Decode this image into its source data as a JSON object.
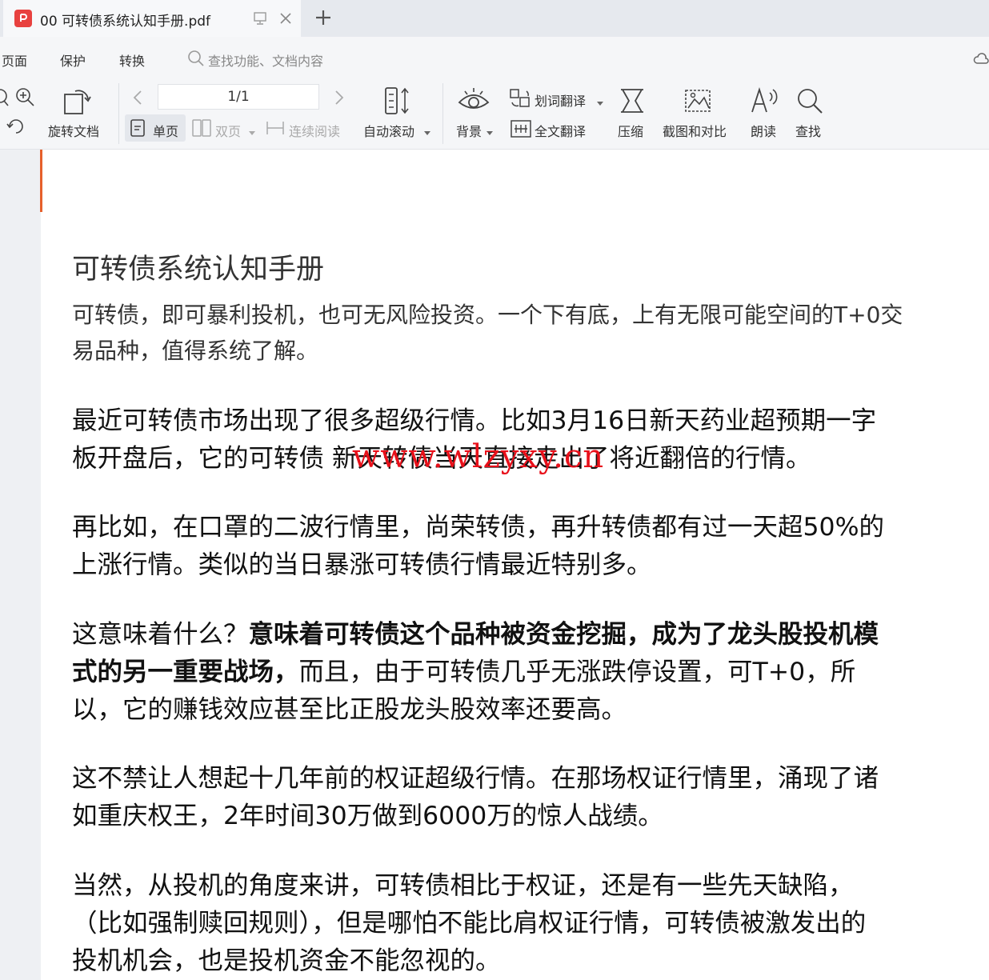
{
  "tab": {
    "title": "00 可转债系统认知手册.pdf"
  },
  "menu": {
    "items": [
      "页面",
      "保护",
      "转换"
    ]
  },
  "search": {
    "placeholder": "查找功能、文档内容"
  },
  "toolbar": {
    "rotate_doc": "旋转文档",
    "page_indicator": "1/1",
    "single_page": "单页",
    "double_page": "双页",
    "continuous_read": "连续阅读",
    "auto_scroll": "自动滚动",
    "background": "背景",
    "word_translate": "划词翻译",
    "full_translate": "全文翻译",
    "compress": "压缩",
    "screenshot_compare": "截图和对比",
    "read_aloud": "朗读",
    "find": "查找"
  },
  "document": {
    "title": "可转债系统认知手册",
    "intro": [
      "可转债，即可暴利投机，也可无风险投资。一个下有底，上有无限可能空间的T+0交",
      "易品种，值得系统了解。"
    ],
    "para1": [
      "最近可转债市场出现了很多超级行情。比如3月16日新天药业超预期一字",
      "板开盘后，它的可转债 新天转债当天直接走出了将近翻倍的行情。"
    ],
    "para2": [
      "再比如，在口罩的二波行情里，尚荣转债，再升转债都有过一天超50%的",
      "上涨行情。类似的当日暴涨可转债行情最近特别多。"
    ],
    "para3": {
      "line1_normal": "这意味着什么？",
      "line1_bold": "意味着可转债这个品种被资金挖掘，成为了龙头股投机模",
      "line2_bold": "式的另一重要战场，",
      "line2_normal": "而且，由于可转债几乎无涨跌停设置，可T+0，所",
      "line3": "以，它的赚钱效应甚至比正股龙头股效率还要高。"
    },
    "para4": [
      "这不禁让人想起十几年前的权证超级行情。在那场权证行情里，涌现了诸",
      "如重庆权王，2年时间30万做到6000万的惊人战绩。"
    ],
    "para5": [
      "当然，从投机的角度来讲，可转债相比于权证，还是有一些先天缺陷，",
      "（比如强制赎回规则），但是哪怕不能比肩权证行情，可转债被激发出的",
      "投机机会，也是投机资金不能忽视的。"
    ]
  },
  "watermark": "www.wlzyxy.cn"
}
